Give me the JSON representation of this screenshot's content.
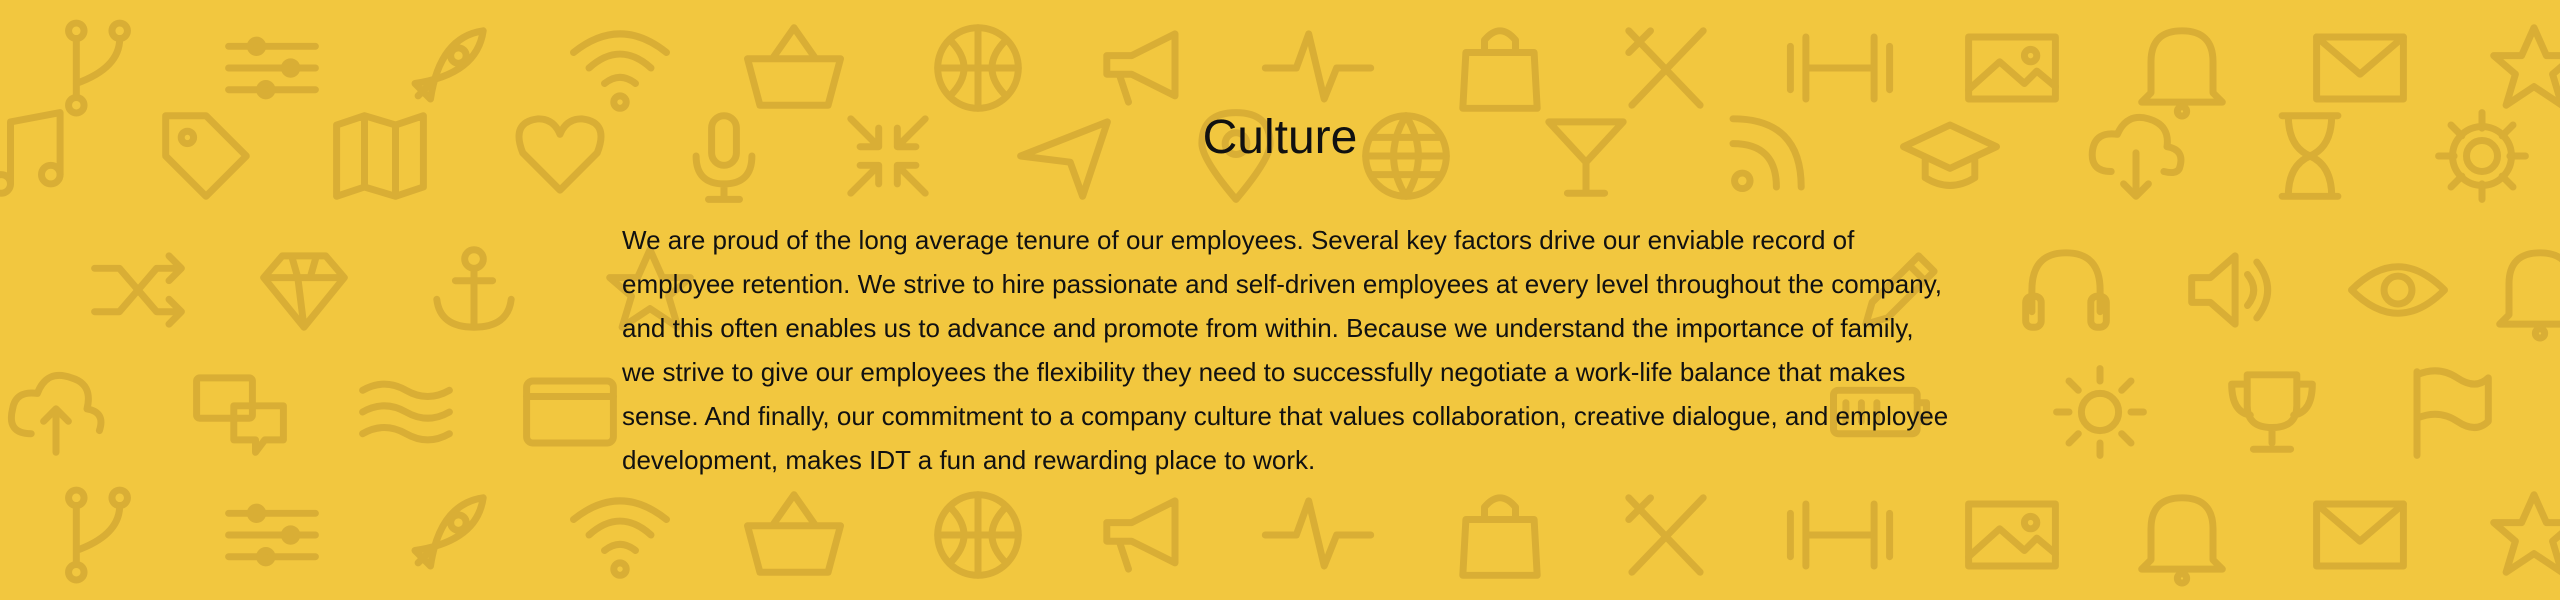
{
  "section": {
    "title": "Culture",
    "body": "We are proud of the long average tenure of our employees. Several key factors drive our enviable record of employee retention. We strive to hire passionate and self-driven employees at every level throughout the company, and this often enables us to advance and promote from within. Because we understand the importance of family, we strive to give our employees the flexibility they need to successfully negotiate a work-life balance that makes sense. And finally, our commitment to a company culture that values collaboration, creative dialogue, and employee development, makes IDT a fun and rewarding place to work."
  },
  "colors": {
    "background": "#F2C73F",
    "icon_pattern": "#D9AE35",
    "text": "#111111"
  },
  "background_icons": [
    [
      "git-branch-icon",
      "sliders-icon",
      "rocket-icon",
      "wifi-icon",
      "basket-icon",
      "basketball-icon",
      "megaphone-icon",
      "pulse-icon",
      "shopping-bag-icon",
      "utensils-icon",
      "dumbbell-icon",
      "image-icon",
      "bell-icon",
      "mail-icon",
      "star-icon"
    ],
    [
      "music-icon",
      "tag-icon",
      "map-icon",
      "heart-icon",
      "microphone-icon",
      "compress-icon",
      "send-icon",
      "map-pin-icon",
      "globe-icon",
      "cocktail-icon",
      "rss-icon",
      "graduation-cap-icon",
      "cloud-download-icon",
      "hourglass-icon",
      "gear-icon"
    ],
    [
      "shuffle-icon",
      "diamond-icon",
      "anchor-icon",
      "star-icon",
      "pencil-icon",
      "headphones-icon",
      "volume-icon",
      "eye-icon",
      "bell-icon"
    ],
    [
      "cloud-upload-icon",
      "chat-icon",
      "waves-icon",
      "wallet-icon",
      "battery-icon",
      "sun-icon",
      "trophy-icon",
      "flag-icon"
    ],
    [
      "git-branch-icon",
      "sliders-icon",
      "rocket-icon",
      "wifi-icon",
      "basket-icon",
      "basketball-icon",
      "megaphone-icon",
      "pulse-icon",
      "shopping-bag-icon",
      "utensils-icon",
      "dumbbell-icon",
      "image-icon",
      "bell-icon",
      "mail-icon",
      "star-icon"
    ]
  ]
}
